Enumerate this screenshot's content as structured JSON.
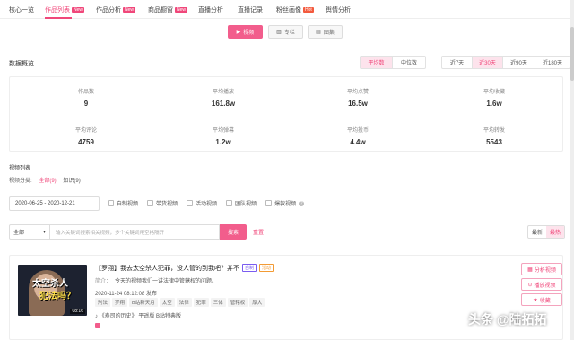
{
  "nav": {
    "items": [
      {
        "label": "核心一览",
        "badge": ""
      },
      {
        "label": "作品列表",
        "badge": "New"
      },
      {
        "label": "作品分析",
        "badge": "New"
      },
      {
        "label": "商品橱窗",
        "badge": "New"
      },
      {
        "label": "直播分析",
        "badge": ""
      },
      {
        "label": "直播记录",
        "badge": ""
      },
      {
        "label": "粉丝画像",
        "badge": "Hot"
      },
      {
        "label": "舆情分析",
        "badge": ""
      }
    ],
    "active": "作品列表"
  },
  "content_type": {
    "buttons": [
      "视频",
      "专栏",
      "图集"
    ],
    "active": "视频"
  },
  "overview": {
    "title": "数据概览",
    "metric_toggle": [
      "平均数",
      "中位数"
    ],
    "metric_active": "平均数",
    "range_toggle": [
      "近7天",
      "近30天",
      "近90天",
      "近180天"
    ],
    "range_active": "近30天",
    "stats": [
      {
        "label": "作品数",
        "value": "9"
      },
      {
        "label": "平均播放",
        "value": "161.8w"
      },
      {
        "label": "平均点赞",
        "value": "16.5w"
      },
      {
        "label": "平均收藏",
        "value": "1.6w"
      },
      {
        "label": "平均评论",
        "value": "4759"
      },
      {
        "label": "平均弹幕",
        "value": "1.2w"
      },
      {
        "label": "平均投币",
        "value": "4.4w"
      },
      {
        "label": "平均转发",
        "value": "5543"
      }
    ]
  },
  "video_list": {
    "title": "视频列表",
    "category_label": "视频分类:",
    "categories": [
      "全部(9)",
      "知识(9)"
    ],
    "category_active": "全部(9)",
    "date_range": "2020-06-25 - 2020-12-21",
    "checkboxes": [
      "自制视频",
      "带货视频",
      "活动视频",
      "团队视频",
      "爆款视频"
    ],
    "select_value": "全部",
    "search_placeholder": "输入关键词搜索相关视频，多个关键词用空格隔开",
    "search_button": "搜索",
    "reset_label": "重置",
    "sort_options": [
      "最新",
      "最热"
    ],
    "sort_active": "最热"
  },
  "video_card": {
    "thumbnail_caption_1": "太空杀人",
    "thumbnail_caption_2": "犯法吗？",
    "duration": "08:16",
    "title": "【罗翔】我去太空杀人犯罪，没人管的到我吧？并不",
    "tag_self": "自制",
    "tag_activity": "活动",
    "desc_label": "简介：",
    "desc": "今天的视频我们一讲法律中管辖权的问题。",
    "published": "2020-11-24 08:12:08 发布",
    "keywords": [
      "刑法",
      "罗翔",
      "B站新天月",
      "太空",
      "法律",
      "犯罪",
      "三体",
      "管辖权",
      "厚大"
    ],
    "music": "《寿司的历史》 平遥版 B站特典版",
    "actions": [
      "分析视频",
      "播放视频",
      "收藏"
    ]
  },
  "watermark": "头条 @陆拓拓",
  "colors": {
    "accent": "#f0477a",
    "accent_bg": "#fde3ec",
    "button": "#f25d8c"
  }
}
